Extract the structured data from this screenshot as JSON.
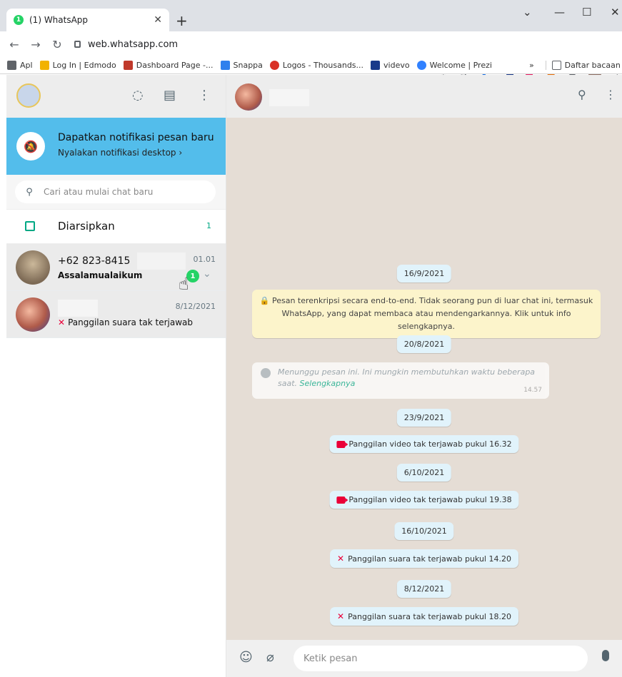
{
  "browser": {
    "tab_title": "(1) WhatsApp",
    "tab_badge": "1",
    "url": "web.whatsapp.com",
    "bookmarks": [
      {
        "label": "Apl",
        "color": "#5f6368"
      },
      {
        "label": "Log In | Edmodo",
        "color": "#f2b200"
      },
      {
        "label": "Dashboard Page -...",
        "color": "#c0392b"
      },
      {
        "label": "Snappa",
        "color": "#2f80ed"
      },
      {
        "label": "Logos - Thousands...",
        "color": "#d93025"
      },
      {
        "label": "videvo",
        "color": "#1a3a8a"
      },
      {
        "label": "Welcome | Prezi",
        "color": "#3181ff"
      },
      {
        "label": "»",
        "color": ""
      },
      {
        "label": "Daftar bacaan",
        "color": "#5f6368"
      }
    ]
  },
  "sidebar": {
    "notification": {
      "title": "Dapatkan notifikasi pesan baru",
      "subtitle": "Nyalakan notifikasi desktop ›"
    },
    "search": {
      "placeholder": "Cari atau mulai chat baru"
    },
    "archived": {
      "label": "Diarsipkan",
      "count": "1"
    },
    "chats": [
      {
        "name": "+62 823-8415",
        "time": "01.01",
        "message": "Assalamualaikum",
        "unread": "1"
      },
      {
        "name": "",
        "time": "8/12/2021",
        "message": "Panggilan suara tak terjawab"
      }
    ]
  },
  "conversation": {
    "messages": [
      {
        "type": "date",
        "text": "16/9/2021"
      },
      {
        "type": "encryption",
        "text": "🔒 Pesan terenkripsi secara end-to-end. Tidak seorang pun di luar chat ini, termasuk WhatsApp, yang dapat membaca atau mendengarkannya. Klik untuk info selengkapnya."
      },
      {
        "type": "date",
        "text": "20/8/2021"
      },
      {
        "type": "waiting",
        "text": "Menunggu pesan ini. Ini mungkin membutuhkan waktu beberapa saat.",
        "link": "Selengkapnya",
        "time": "14.57"
      },
      {
        "type": "date",
        "text": "23/9/2021"
      },
      {
        "type": "video-missed",
        "text": "Panggilan video tak terjawab pukul 16.32"
      },
      {
        "type": "date",
        "text": "6/10/2021"
      },
      {
        "type": "video-missed",
        "text": "Panggilan video tak terjawab pukul 19.38"
      },
      {
        "type": "date",
        "text": "16/10/2021"
      },
      {
        "type": "voice-missed",
        "text": "Panggilan suara tak terjawab pukul 14.20"
      },
      {
        "type": "date",
        "text": "8/12/2021"
      },
      {
        "type": "voice-missed",
        "text": "Panggilan suara tak terjawab pukul 18.20"
      }
    ]
  },
  "composer": {
    "placeholder": "Ketik pesan"
  }
}
